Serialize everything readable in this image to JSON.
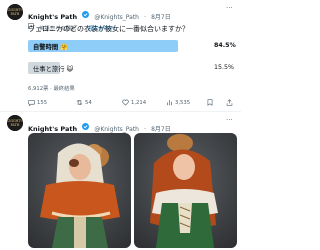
{
  "tweet1": {
    "author_name": "Knight's Path",
    "author_handle": "@Knights_Path",
    "date": "8月7日",
    "translated_from": "英語からの翻訳",
    "show_original": "原文を表示",
    "text": "ヴェロニカのどの衣装が彼女に一番似合いますか？",
    "poll": {
      "options": [
        {
          "label": "自警時間 🤗",
          "percent_text": "84.5%",
          "percent": 84.5,
          "winner": true
        },
        {
          "label": "仕事と旅行 😺",
          "percent_text": "15.5%",
          "percent": 15.5,
          "winner": false
        }
      ],
      "summary": "6,912票 · 最終結果"
    },
    "actions": {
      "replies": "155",
      "reposts": "54",
      "likes": "1,214",
      "views": "3,535"
    }
  },
  "tweet2": {
    "author_name": "Knight's Path",
    "author_handle": "@Knights_Path",
    "date": "8月7日"
  },
  "colors": {
    "winner_bar": "#8ecdf7",
    "loser_bar": "#cfd9de",
    "link": "#1d9bf0",
    "verified": "#1d9bf0",
    "muted": "#536471"
  }
}
